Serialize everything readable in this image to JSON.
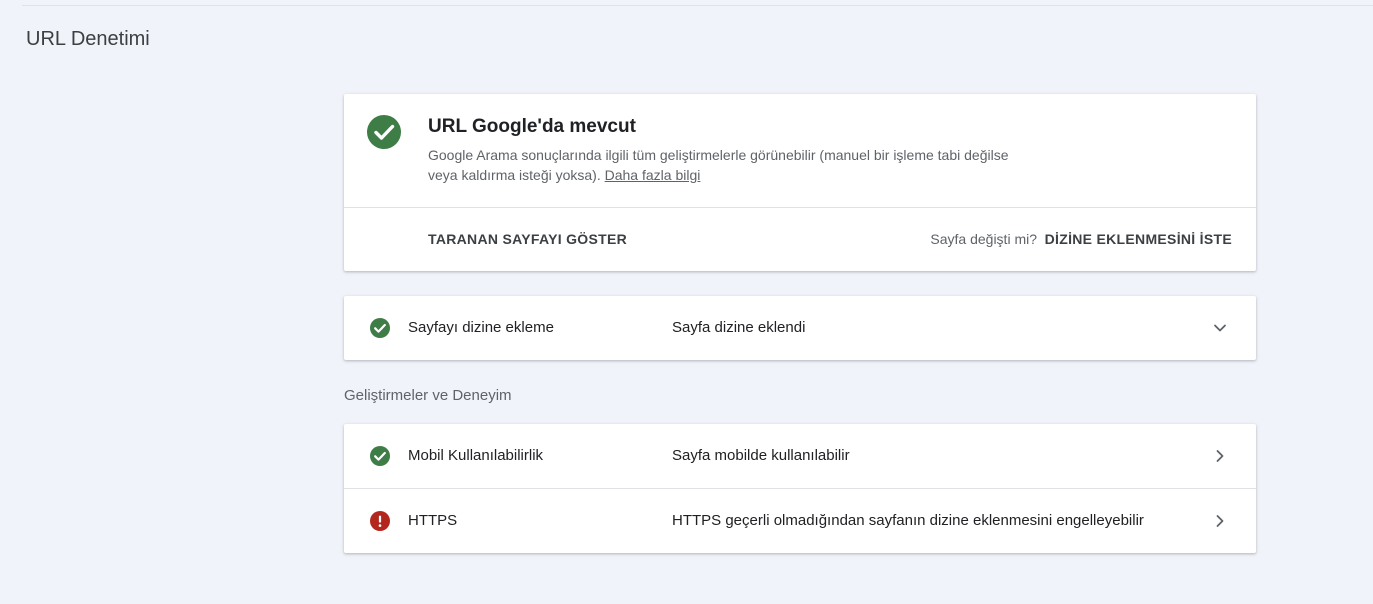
{
  "page": {
    "title": "URL Denetimi"
  },
  "summary": {
    "title": "URL Google'da mevcut",
    "description": "Google Arama sonuçlarında ilgili tüm geliştirmelerle görünebilir (manuel bir işleme tabi değilse veya kaldırma isteği yoksa).",
    "learn_more": "Daha fazla bilgi",
    "view_crawled_label": "TARANAN SAYFAYI GÖSTER",
    "page_changed_question": "Sayfa değişti mi?",
    "request_indexing_label": "DİZİNE EKLENMESİNİ İSTE",
    "status_color": "#3e7d46"
  },
  "indexing": {
    "label": "Sayfayı dizine ekleme",
    "status": "Sayfa dizine eklendi",
    "state": "ok"
  },
  "enhancements": {
    "heading": "Geliştirmeler ve Deneyim",
    "items": [
      {
        "label": "Mobil Kullanılabilirlik",
        "status": "Sayfa mobilde kullanılabilir",
        "state": "ok"
      },
      {
        "label": "HTTPS",
        "status": "HTTPS geçerli olmadığından sayfanın dizine eklenmesini engelleyebilir",
        "state": "error"
      }
    ]
  },
  "colors": {
    "ok": "#3e7d46",
    "error": "#b3261e",
    "background": "#f1f3fa"
  }
}
